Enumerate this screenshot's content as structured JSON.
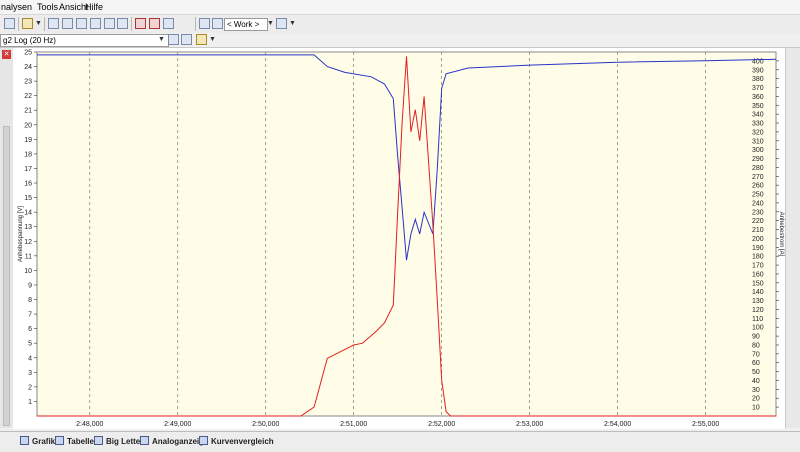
{
  "menu": {
    "items": [
      "nalysen",
      "Tools",
      "Ansicht",
      "Hilfe"
    ]
  },
  "toolbar": {
    "work_select": "< Work >"
  },
  "toolbar2": {
    "log_select": "g2 Log (20 Hz)"
  },
  "tabs": [
    "Grafik",
    "Tabelle",
    "Big Letter",
    "Analoganzeige",
    "Kurvenvergleich"
  ],
  "colors": {
    "plot_background": "#fffde8",
    "voltage": "#2b33c8",
    "current": "#e02020"
  },
  "chart_data": {
    "type": "line",
    "x_ticks": [
      "2:48,000",
      "2:49,000",
      "2:50,000",
      "2:51,000",
      "2:52,000",
      "2:53,000",
      "2:54,000",
      "2:55,000"
    ],
    "xlim_seconds": [
      167.4,
      175.8
    ],
    "y_left": {
      "label": "Anhebespannung [V]",
      "ylim": [
        0,
        25
      ],
      "ticks": [
        1,
        2,
        3,
        4,
        5,
        6,
        7,
        8,
        9,
        10,
        11,
        12,
        13,
        14,
        15,
        16,
        17,
        18,
        19,
        20,
        21,
        22,
        23,
        24,
        25
      ]
    },
    "y_right": {
      "label": "Anhebestrom [A]",
      "ylim": [
        0,
        410
      ],
      "ticks": [
        10,
        20,
        30,
        40,
        50,
        60,
        70,
        80,
        90,
        100,
        110,
        120,
        130,
        140,
        150,
        160,
        170,
        180,
        190,
        200,
        210,
        220,
        230,
        240,
        250,
        260,
        270,
        280,
        290,
        300,
        310,
        320,
        330,
        340,
        350,
        360,
        370,
        380,
        390,
        400
      ]
    },
    "grid": "vertical-dashed",
    "series": [
      {
        "axis": "left",
        "color": "#2b33c8",
        "x": [
          167.4,
          169.0,
          170.0,
          170.55,
          170.7,
          170.9,
          171.2,
          171.35,
          171.45,
          171.5,
          171.55,
          171.6,
          171.65,
          171.7,
          171.75,
          171.8,
          171.9,
          171.95,
          172.0,
          172.05,
          172.3,
          173.0,
          174.0,
          175.0,
          175.8
        ],
        "y": [
          24.8,
          24.8,
          24.8,
          24.8,
          24.0,
          23.6,
          23.3,
          22.8,
          21.8,
          17.8,
          14.3,
          10.7,
          12.5,
          13.5,
          12.5,
          14.0,
          12.5,
          17.0,
          22.5,
          23.5,
          23.9,
          24.1,
          24.3,
          24.4,
          24.5
        ]
      },
      {
        "axis": "right",
        "color": "#e02020",
        "x": [
          167.4,
          170.4,
          170.55,
          170.7,
          170.9,
          171.0,
          171.1,
          171.25,
          171.35,
          171.45,
          171.5,
          171.55,
          171.6,
          171.65,
          171.7,
          171.75,
          171.8,
          171.9,
          171.95,
          172.0,
          172.05,
          172.1,
          173.0,
          175.8
        ],
        "y": [
          0,
          0,
          10,
          65,
          75,
          80,
          82,
          95,
          105,
          125,
          230,
          330,
          405,
          320,
          345,
          310,
          360,
          215,
          130,
          40,
          5,
          0,
          0,
          0
        ]
      }
    ]
  }
}
